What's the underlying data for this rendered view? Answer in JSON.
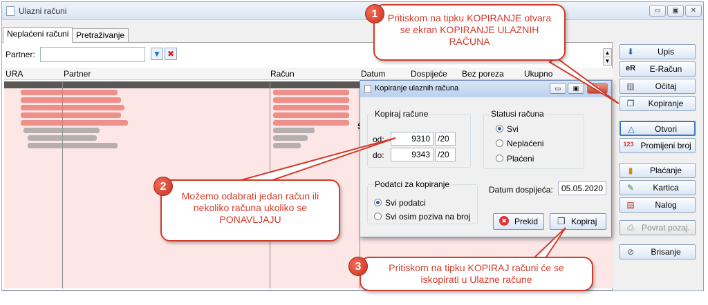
{
  "window": {
    "title": "Ulazni računi",
    "controls": {
      "minimize": "▭",
      "maximize": "▣",
      "close": "✕"
    }
  },
  "tabs": [
    {
      "label": "Neplaćeni računi",
      "active": true
    },
    {
      "label": "Pretraživanje",
      "active": false
    }
  ],
  "filter": {
    "partner_label": "Partner:",
    "partner_value": "",
    "filter_icon": "funnel-icon",
    "clear_filter_icon": "clear-filter-icon"
  },
  "grid": {
    "columns": [
      "URA",
      "Partner",
      "Račun",
      "Datum",
      "Dospijeće",
      "Bez poreza",
      "Ukupno"
    ],
    "rows_note_visible": "S"
  },
  "side_buttons": [
    {
      "label": "Upis",
      "icon": "upis-icon",
      "glyph": "⬇",
      "enabled": true
    },
    {
      "label": "E-Račun",
      "icon": "eracun-icon",
      "glyph": "eR",
      "enabled": true
    },
    {
      "label": "Očitaj",
      "icon": "barcode-icon",
      "glyph": "▥",
      "enabled": true
    },
    {
      "label": "Kopiranje",
      "icon": "copy-icon",
      "glyph": "❐",
      "enabled": true
    },
    {
      "label": "Otvori",
      "icon": "open-icon",
      "glyph": "△",
      "enabled": true
    },
    {
      "label": "Promijeni broj",
      "icon": "number-icon",
      "glyph": "123",
      "enabled": true
    },
    {
      "label": "Plaćanje",
      "icon": "payment-icon",
      "glyph": "▮",
      "enabled": true
    },
    {
      "label": "Kartica",
      "icon": "card-icon",
      "glyph": "✎",
      "enabled": true
    },
    {
      "label": "Nalog",
      "icon": "order-icon",
      "glyph": "▤",
      "enabled": true
    },
    {
      "label": "Povrat pozaj.",
      "icon": "printer-icon",
      "glyph": "⎙",
      "enabled": false
    },
    {
      "label": "Brisanje",
      "icon": "delete-icon",
      "glyph": "⊘",
      "enabled": true
    }
  ],
  "dialog": {
    "title": "Kopiranje ulaznih računa",
    "copy_group": {
      "title": "Kopiraj račune",
      "from_label": "od:",
      "from_value": "9310",
      "from_suffix": "/20",
      "to_label": "do:",
      "to_value": "9343",
      "to_suffix": "/20"
    },
    "status_group": {
      "title": "Statusi računa",
      "options": [
        {
          "label": "Svi",
          "selected": true
        },
        {
          "label": "Neplaćeni",
          "selected": false
        },
        {
          "label": "Plaćeni",
          "selected": false
        }
      ]
    },
    "data_group": {
      "title": "Podatci za kopiranje",
      "options": [
        {
          "label": "Svi podatci",
          "selected": true
        },
        {
          "label": "Svi osim poziva na broj",
          "selected": false
        }
      ]
    },
    "due_date_label": "Datum dospijeća:",
    "due_date_value": "05.05.2020",
    "cancel_label": "Prekid",
    "copy_label": "Kopiraj"
  },
  "callouts": [
    {
      "number": "1",
      "text": "Pritiskom na tipku KOPIRANJE otvara se ekran KOPIRANJE ULAZNIH RAČUNA"
    },
    {
      "number": "2",
      "text": "Možemo odabrati jedan račun ili nekoliko računa ukoliko se PONAVLJAJU"
    },
    {
      "number": "3",
      "text": "Pritiskom na tipku KOPIRAJ računi će se iskopirati u Ulazne račune"
    }
  ],
  "colors": {
    "callout_red": "#d23b2a",
    "grid_background": "#fde6e6",
    "blurred_row_red": "#e8736b"
  }
}
